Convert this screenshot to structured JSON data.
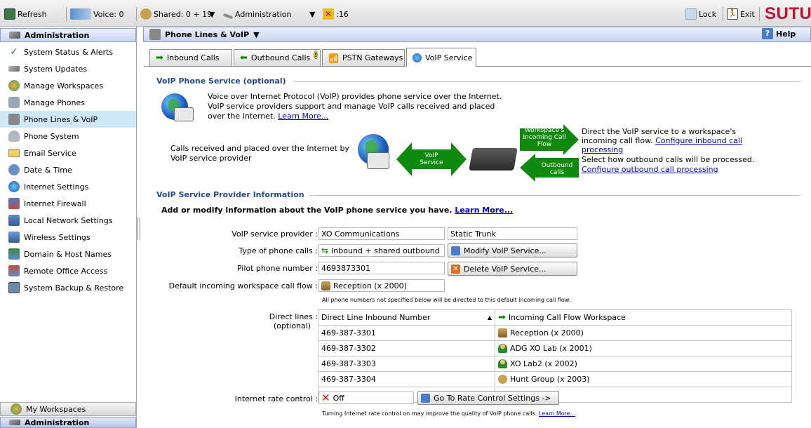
{
  "toolbar": {
    "refresh": "Refresh",
    "voice": "Voice: 0",
    "shared": "Shared: 0 + 19",
    "administration": "Administration",
    "alerts": ":16",
    "lock": "Lock",
    "exit": "Exit",
    "brand": "SUTUS"
  },
  "sidebar": {
    "header": "Administration",
    "items": [
      {
        "label": "System Status & Alerts"
      },
      {
        "label": "System Updates"
      },
      {
        "label": "Manage Workspaces"
      },
      {
        "label": "Manage Phones"
      },
      {
        "label": "Phone Lines & VoIP"
      },
      {
        "label": "Phone System"
      },
      {
        "label": "Email Service"
      },
      {
        "label": "Date & Time"
      },
      {
        "label": "Internet Settings"
      },
      {
        "label": "Internet Firewall"
      },
      {
        "label": "Local Network Settings"
      },
      {
        "label": "Wireless Settings"
      },
      {
        "label": "Domain & Host Names"
      },
      {
        "label": "Remote Office Access"
      },
      {
        "label": "System Backup & Restore"
      }
    ],
    "bottom_my_workspaces": "My Workspaces",
    "bottom_administration": "Administration"
  },
  "main": {
    "title": "Phone Lines & VoIP",
    "help": "Help",
    "tabs": [
      {
        "label": "Inbound Calls"
      },
      {
        "label": "Outbound Calls"
      },
      {
        "label": "PSTN Gateways"
      },
      {
        "label": "VoIP Service"
      }
    ]
  },
  "voip": {
    "section_title": "VoIP Phone Service (optional)",
    "desc_line1": "Voice over Internet Protocol (VoIP) provides phone service over the Internet.",
    "desc_line2": "VoIP service providers support and manage VoIP calls received and placed",
    "desc_line3": "over the Internet.",
    "learn_more": "Learn More...",
    "calls_text_line1": "Calls received and placed over the Internet by",
    "calls_text_line2": "VoIP service provider",
    "voip_service_arrow_1": "VoIP",
    "voip_service_arrow_2": "Service",
    "incoming_arrow_1": "Workspace's",
    "incoming_arrow_2": "Incoming Call",
    "incoming_arrow_3": "Flow",
    "outbound_arrow_1": "Outbound",
    "outbound_arrow_2": "calls",
    "direct_text_line1": "Direct the VoIP service to a workspace's",
    "direct_text_line2": "incoming call flow.",
    "configure_inbound_1": "Configure inbound call",
    "configure_inbound_2": "processing",
    "select_text": "Select how outbound calls will be processed.",
    "configure_outbound": "Configure outbound call processing"
  },
  "provider": {
    "section_title": "VoIP Service Provider Information",
    "add_modify": "Add or modify information about the VoIP phone service you have.",
    "learn_more": "Learn More...",
    "provider_label": "VoIP service provider :",
    "provider_value": "XO Communications",
    "trunk_value": "Static Trunk",
    "type_label": "Type of phone calls :",
    "type_value": "Inbound + shared outbound",
    "modify_button": "Modify VoIP Service...",
    "pilot_label": "Pilot phone number :",
    "pilot_value": "4693873301",
    "delete_button": "Delete VoIP Service...",
    "default_label": "Default incoming workspace call flow :",
    "default_value": "Reception (x 2000)",
    "default_note": "All phone numbers not specified below will be directed to this default incoming call flow.",
    "direct_label_1": "Direct lines :",
    "direct_label_2": "(optional)",
    "table_headers": [
      "Direct Line Inbound Number",
      "Incoming Call Flow Workspace"
    ],
    "rows": [
      {
        "number": "469-387-3301",
        "workspace": "Reception (x 2000)",
        "icon": "reception-icon"
      },
      {
        "number": "469-387-3302",
        "workspace": "ADG XO Lab (x 2001)",
        "icon": "user-icon"
      },
      {
        "number": "469-387-3303",
        "workspace": "XO Lab2 (x 2002)",
        "icon": "user-icon"
      },
      {
        "number": "469-387-3304",
        "workspace": "Hunt Group (x 2003)",
        "icon": "hunt-group-icon"
      },
      {
        "number": "",
        "workspace": ""
      }
    ],
    "rate_label": "Internet rate control :",
    "rate_value": "Off",
    "rate_button": "Go To Rate Control Settings ->",
    "rate_note": "Turning Internet rate control on may improve the quality of VoIP phone calls.",
    "rate_learn_more": "Learn More..."
  },
  "colors": {
    "accent_blue": "#234a8a",
    "arrow_green": "#0f8a0f",
    "brand_red": "#c8102e",
    "active_row": "#cfe8f8"
  }
}
